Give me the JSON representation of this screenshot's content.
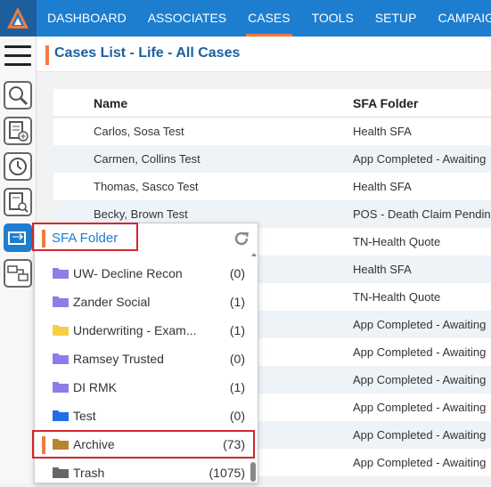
{
  "nav": {
    "logo": "logo-icon",
    "items": [
      {
        "label": "DASHBOARD",
        "active": false
      },
      {
        "label": "ASSOCIATES",
        "active": false
      },
      {
        "label": "CASES",
        "active": true
      },
      {
        "label": "TOOLS",
        "active": false
      },
      {
        "label": "SETUP",
        "active": false
      },
      {
        "label": "CAMPAIGN",
        "active": false
      }
    ]
  },
  "page": {
    "title": "Cases List - Life - All Cases"
  },
  "table": {
    "columns": [
      "Name",
      "SFA Folder"
    ],
    "rows": [
      {
        "name": "Carlos, Sosa Test",
        "folder": "Health SFA"
      },
      {
        "name": "Carmen, Collins Test",
        "folder": "App Completed - Awaiting"
      },
      {
        "name": "Thomas, Sasco Test",
        "folder": "Health SFA"
      },
      {
        "name": "Becky, Brown Test",
        "folder": "POS - Death Claim Pending"
      },
      {
        "name": "",
        "folder": "TN-Health Quote"
      },
      {
        "name": "",
        "folder": "Health SFA"
      },
      {
        "name": "",
        "folder": "TN-Health Quote"
      },
      {
        "name": "",
        "folder": "App Completed - Awaiting"
      },
      {
        "name": "",
        "folder": "App Completed - Awaiting"
      },
      {
        "name": "",
        "folder": "App Completed - Awaiting"
      },
      {
        "name": "",
        "folder": "App Completed - Awaiting"
      },
      {
        "name": "",
        "folder": "App Completed - Awaiting"
      },
      {
        "name": "",
        "folder": "App Completed - Awaiting"
      }
    ]
  },
  "popup": {
    "title": "SFA Folder",
    "refresh_icon": "refresh-icon",
    "folders": [
      {
        "name": "UW- Decline Recon",
        "count": "(0)",
        "color": "#8c7ee8"
      },
      {
        "name": "Zander Social",
        "count": "(1)",
        "color": "#8c7ee8"
      },
      {
        "name": "Underwriting - Exam...",
        "count": "(1)",
        "color": "#f3cf4a"
      },
      {
        "name": "Ramsey Trusted",
        "count": "(0)",
        "color": "#8c7ee8"
      },
      {
        "name": "DI RMK",
        "count": "(1)",
        "color": "#8c7ee8"
      },
      {
        "name": "Test",
        "count": "(0)",
        "color": "#1e6ee8"
      },
      {
        "name": "Archive",
        "count": "(73)",
        "color": "#b8862a"
      },
      {
        "name": "Trash",
        "count": "(1075)",
        "color": "#666666"
      }
    ]
  },
  "colors": {
    "brand_blue": "#1d7ed0",
    "accent_orange": "#f47a3c",
    "highlight_red": "#d3262e"
  }
}
